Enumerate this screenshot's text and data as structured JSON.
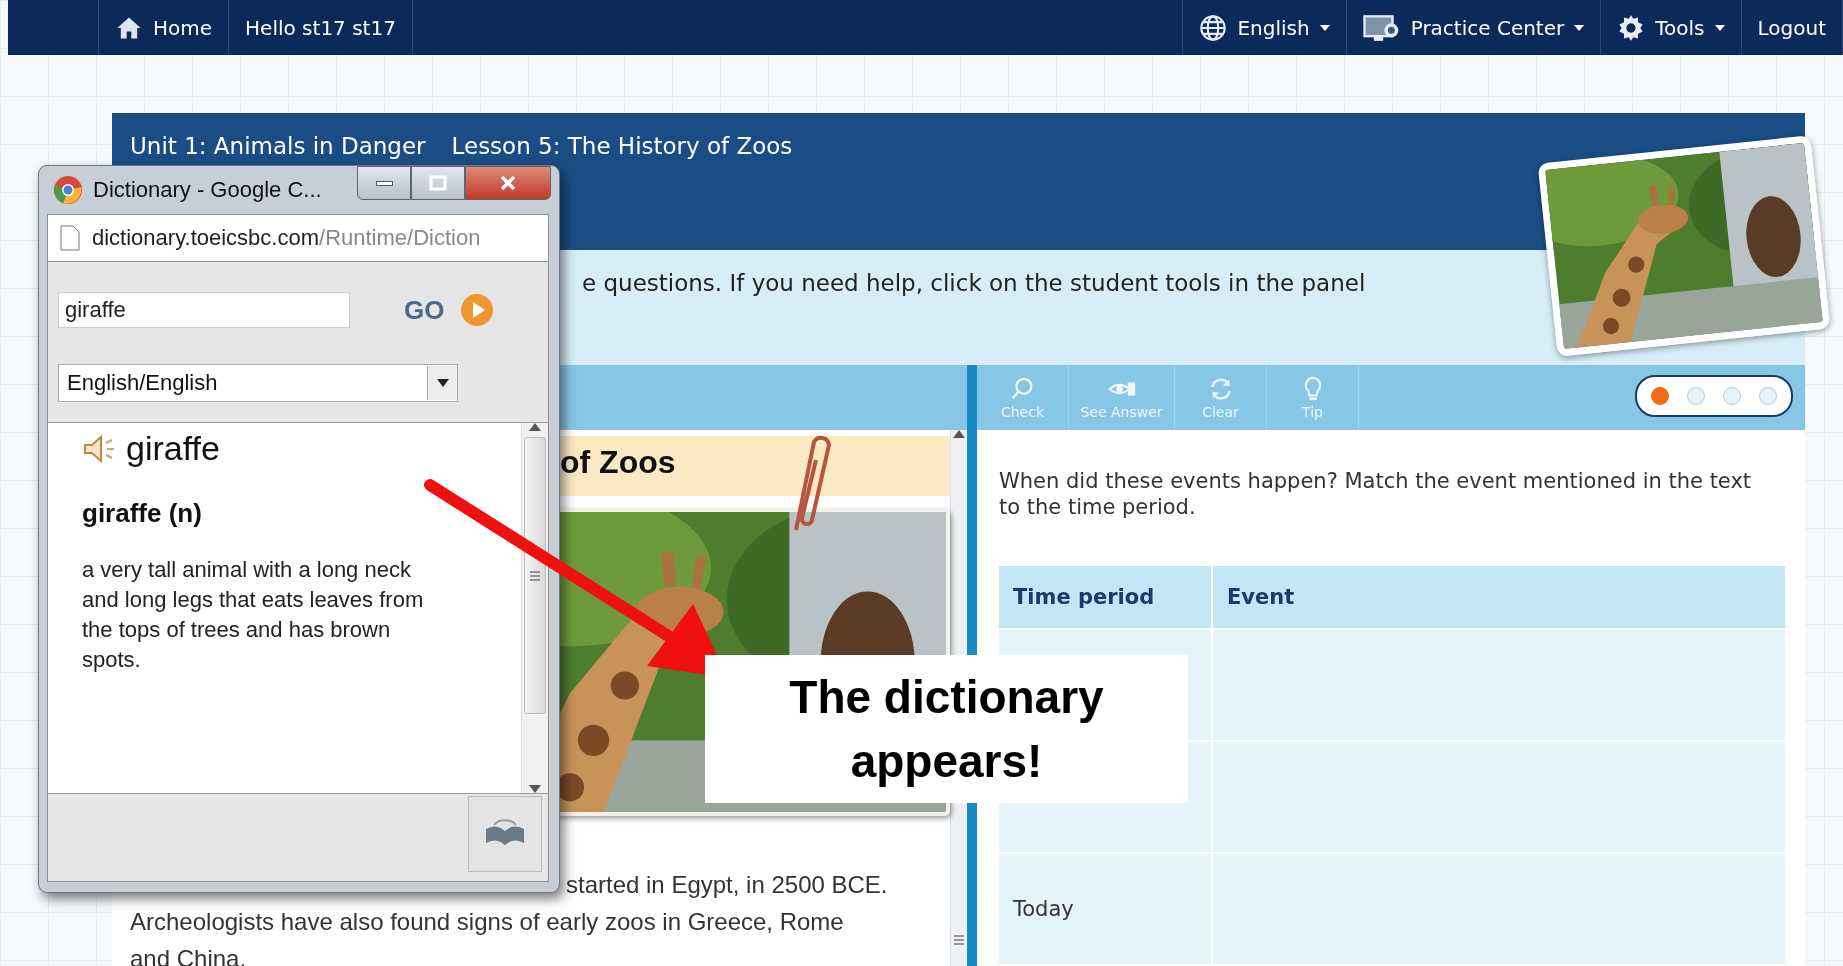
{
  "nav": {
    "left": [
      {
        "kind": "home",
        "label": "Home"
      },
      {
        "kind": "greeting",
        "label": "Hello st17 st17"
      }
    ],
    "right": [
      {
        "kind": "language",
        "label": "English",
        "dropdown": true
      },
      {
        "kind": "practice",
        "label": "Practice Center",
        "dropdown": true
      },
      {
        "kind": "tools",
        "label": "Tools",
        "dropdown": true
      },
      {
        "kind": "logout",
        "label": "Logout",
        "dropdown": false
      }
    ]
  },
  "lesson": {
    "unit": "Unit 1: Animals in Danger",
    "title": "Lesson 5: The History of Zoos",
    "instruction": "e questions. If you need help, click on the student tools in the panel"
  },
  "reading": {
    "title": "of Zoos",
    "lines": [
      "started in Egypt, in 2500 BCE.",
      "Archeologists have also found signs of early zoos in Greece, Rome",
      "and China."
    ]
  },
  "toolbar": {
    "tools": [
      {
        "kind": "check",
        "label": "Check"
      },
      {
        "kind": "answer",
        "label": "See Answer"
      },
      {
        "kind": "clear",
        "label": "Clear"
      },
      {
        "kind": "tip",
        "label": "Tip"
      }
    ],
    "pager": [
      {
        "selected": true
      },
      {
        "selected": false
      },
      {
        "selected": false
      },
      {
        "selected": false
      }
    ]
  },
  "question": {
    "text": "When did these events happen? Match the event mentioned in the text to the time period.",
    "columns": [
      "Time period",
      "Event"
    ],
    "rows": [
      {
        "kind": "blank"
      },
      {
        "kind": "blank"
      },
      {
        "kind": "text",
        "time_period": "Today"
      }
    ]
  },
  "popup": {
    "title": "Dictionary - Google C...",
    "url_host": "dictionary.toeicsbc.com",
    "url_path": "/Runtime/Diction",
    "search": "giraffe",
    "go": "GO",
    "language": "English/English",
    "word": "giraffe",
    "headword": "giraffe (n)",
    "definition": "a very tall animal with a long neck and long legs that eats leaves from the tops of trees and has brown spots."
  },
  "callout": {
    "text": "The dictionary appears!"
  }
}
